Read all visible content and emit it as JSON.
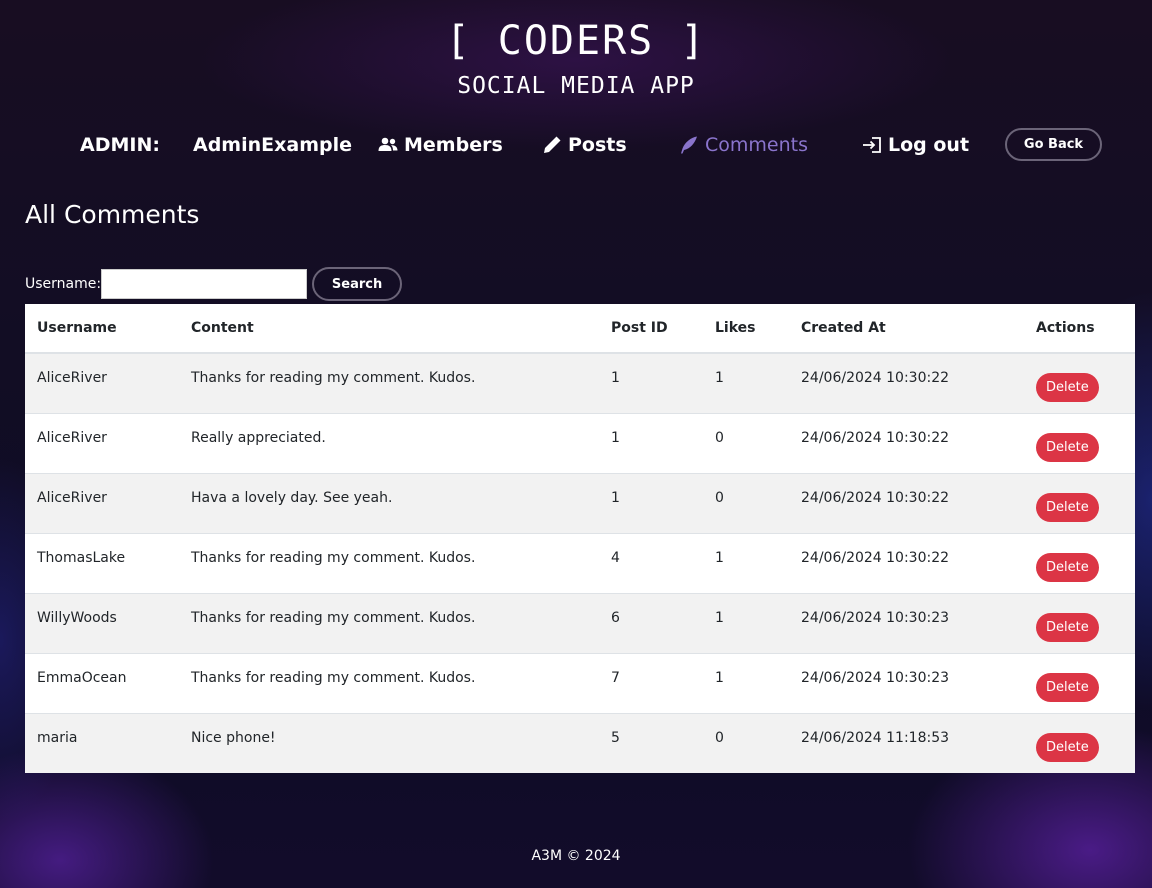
{
  "header": {
    "brand": "[ CODERS ]",
    "subtitle": "SOCIAL MEDIA APP"
  },
  "nav": {
    "admin_label": "ADMIN:",
    "admin_name": "AdminExample",
    "members": "Members",
    "posts": "Posts",
    "comments": "Comments",
    "logout": "Log out",
    "go_back": "Go Back",
    "active_color": "#8a74cc"
  },
  "page": {
    "title": "All Comments"
  },
  "search": {
    "label": "Username:",
    "value": "",
    "button": "Search"
  },
  "table": {
    "headers": [
      "Username",
      "Content",
      "Post ID",
      "Likes",
      "Created At",
      "Actions"
    ],
    "rows": [
      {
        "username": "AliceRiver",
        "content": "Thanks for reading my comment. Kudos.",
        "post_id": "1",
        "likes": "1",
        "created_at": "24/06/2024 10:30:22",
        "action": "Delete"
      },
      {
        "username": "AliceRiver",
        "content": "Really appreciated.",
        "post_id": "1",
        "likes": "0",
        "created_at": "24/06/2024 10:30:22",
        "action": "Delete"
      },
      {
        "username": "AliceRiver",
        "content": "Hava a lovely day. See yeah.",
        "post_id": "1",
        "likes": "0",
        "created_at": "24/06/2024 10:30:22",
        "action": "Delete"
      },
      {
        "username": "ThomasLake",
        "content": "Thanks for reading my comment. Kudos.",
        "post_id": "4",
        "likes": "1",
        "created_at": "24/06/2024 10:30:22",
        "action": "Delete"
      },
      {
        "username": "WillyWoods",
        "content": "Thanks for reading my comment. Kudos.",
        "post_id": "6",
        "likes": "1",
        "created_at": "24/06/2024 10:30:23",
        "action": "Delete"
      },
      {
        "username": "EmmaOcean",
        "content": "Thanks for reading my comment. Kudos.",
        "post_id": "7",
        "likes": "1",
        "created_at": "24/06/2024 10:30:23",
        "action": "Delete"
      },
      {
        "username": "maria",
        "content": "Nice phone!",
        "post_id": "5",
        "likes": "0",
        "created_at": "24/06/2024 11:18:53",
        "action": "Delete"
      }
    ]
  },
  "footer": {
    "text": "A3M © 2024"
  },
  "colors": {
    "delete_button": "#dc3545",
    "background": "#120d24"
  }
}
